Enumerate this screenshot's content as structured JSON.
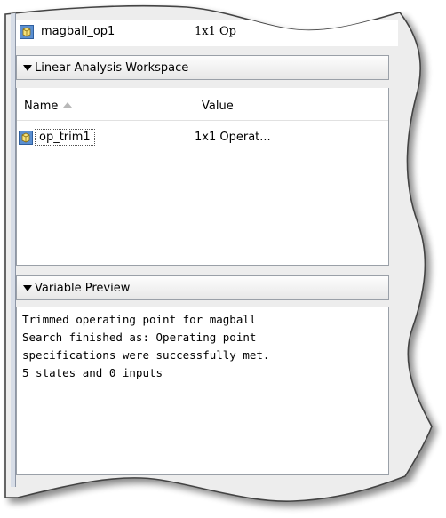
{
  "top_row": {
    "name": "magball_op1",
    "value": "1x1 Op"
  },
  "workspace": {
    "header": "Linear Analysis Workspace",
    "columns": [
      "Name",
      "Value",
      ""
    ],
    "rows": [
      {
        "name": "op_trim1",
        "value": "1x1 Operat..."
      }
    ]
  },
  "preview": {
    "header": "Variable Preview",
    "lines": [
      "Trimmed operating point for magball",
      "Search finished as: Operating point",
      "specifications were successfully met.",
      "5 states and 0 inputs"
    ]
  },
  "icons": {
    "workspace_variable": "operating-point-icon"
  }
}
